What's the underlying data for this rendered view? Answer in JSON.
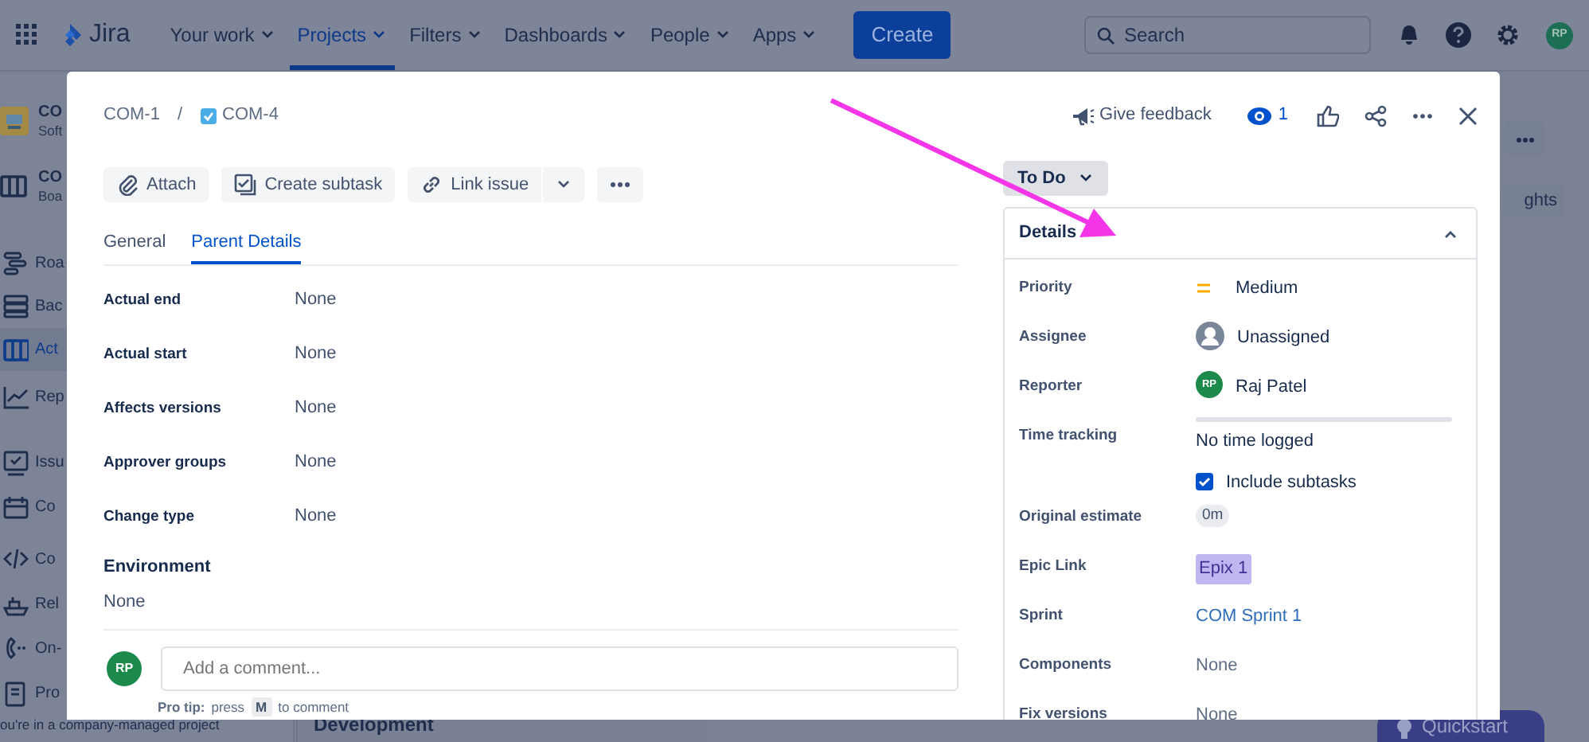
{
  "topnav": {
    "logo": "Jira",
    "items": [
      {
        "label": "Your work",
        "selected": false
      },
      {
        "label": "Projects",
        "selected": true
      },
      {
        "label": "Filters",
        "selected": false
      },
      {
        "label": "Dashboards",
        "selected": false
      },
      {
        "label": "People",
        "selected": false
      },
      {
        "label": "Apps",
        "selected": false
      }
    ],
    "create": "Create",
    "search": {
      "placeholder": "Search"
    },
    "avatar": "RP"
  },
  "sidebar": {
    "project": {
      "name": "CO",
      "type": "Soft"
    },
    "board": {
      "name": "CO",
      "type": "Boa"
    },
    "items": [
      {
        "label": "Roa",
        "selected": false
      },
      {
        "label": "Bac",
        "selected": false
      },
      {
        "label": "Act",
        "selected": true
      },
      {
        "label": "Rep",
        "selected": false
      },
      {
        "label": "Issu",
        "selected": false
      },
      {
        "label": "Co",
        "selected": false
      },
      {
        "label": "Co",
        "selected": false
      },
      {
        "label": "Rel",
        "selected": false
      },
      {
        "label": "On-",
        "selected": false
      },
      {
        "label": "Pro",
        "selected": false
      }
    ],
    "footer": "ou're in a company-managed project"
  },
  "board": {
    "column": "Development",
    "insights": "ghts",
    "quickstart": "Quickstart"
  },
  "modal": {
    "breadcrumb": [
      "COM-1",
      "COM-4"
    ],
    "breadcrumb_separator": "/",
    "feedback": "Give feedback",
    "watchers": "1",
    "actions": [
      "Attach",
      "Create subtask",
      "Link issue"
    ],
    "status": "To Do",
    "tabs": [
      {
        "label": "General",
        "selected": false
      },
      {
        "label": "Parent Details",
        "selected": true
      }
    ],
    "fields": [
      {
        "label": "Actual end",
        "value": "None"
      },
      {
        "label": "Actual start",
        "value": "None"
      },
      {
        "label": "Affects versions",
        "value": "None"
      },
      {
        "label": "Approver groups",
        "value": "None"
      },
      {
        "label": "Change type",
        "value": "None"
      }
    ],
    "environment": {
      "heading": "Environment",
      "value": "None"
    },
    "comment": {
      "avatar": "RP",
      "placeholder": "Add a comment...",
      "tip_label": "Pro tip:",
      "tip_before": "press",
      "key": "M",
      "tip_after": "to comment"
    },
    "details": {
      "title": "Details",
      "rows": [
        {
          "kind": "priority",
          "label": "Priority",
          "value": "Medium"
        },
        {
          "kind": "unassigned",
          "label": "Assignee",
          "value": "Unassigned"
        },
        {
          "kind": "user",
          "label": "Reporter",
          "value": "Raj Patel",
          "avatar": "RP"
        },
        {
          "kind": "time",
          "label": "Time tracking",
          "value": "No time logged",
          "option": "Include subtasks",
          "checked": true
        },
        {
          "kind": "pill",
          "label": "Original estimate",
          "value": "0m"
        },
        {
          "kind": "epic",
          "label": "Epic Link",
          "value": "Epix 1"
        },
        {
          "kind": "link",
          "label": "Sprint",
          "value": "COM Sprint 1"
        },
        {
          "kind": "text",
          "label": "Components",
          "value": "None"
        },
        {
          "kind": "text",
          "label": "Fix versions",
          "value": "None"
        }
      ]
    }
  }
}
